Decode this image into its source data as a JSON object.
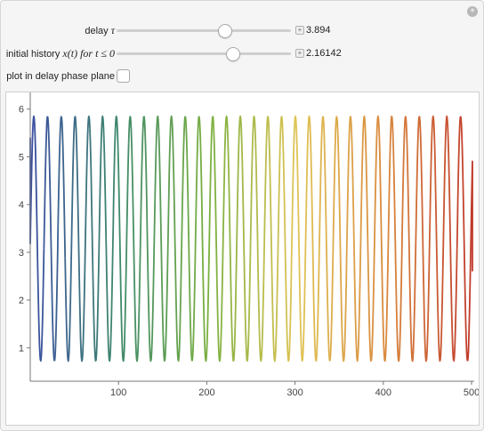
{
  "controls": {
    "delay": {
      "label": "delay",
      "symbol": "τ",
      "value": "3.894",
      "fraction": 0.62
    },
    "history": {
      "label": "initial history",
      "symbol": "x(t) for t ≤ 0",
      "value": "2.16142",
      "fraction": 0.67
    },
    "phase_plane": {
      "label": "plot in delay phase plane",
      "checked": false
    }
  },
  "icons": {
    "reset": "plus-circle-icon",
    "value_toggle": "plus-square-icon"
  },
  "chart_data": {
    "type": "line",
    "title": "",
    "xlabel": "",
    "ylabel": "",
    "xlim": [
      0,
      503
    ],
    "ylim": [
      0.3,
      6.2
    ],
    "x_ticks": [
      100,
      200,
      300,
      400,
      500
    ],
    "y_ticks": [
      1,
      2,
      3,
      4,
      5,
      6
    ],
    "series": [
      {
        "period": 15.6,
        "first_peak_x": 4,
        "peak_y": 5.85,
        "trough_y": 0.72,
        "initial_y": 5.4,
        "end_x": 501,
        "end_y": 2.6,
        "color_gradient": [
          "#3b4fa0",
          "#3f8a6a",
          "#7ab040",
          "#e0c455",
          "#d9893e",
          "#c0392b"
        ]
      }
    ]
  }
}
